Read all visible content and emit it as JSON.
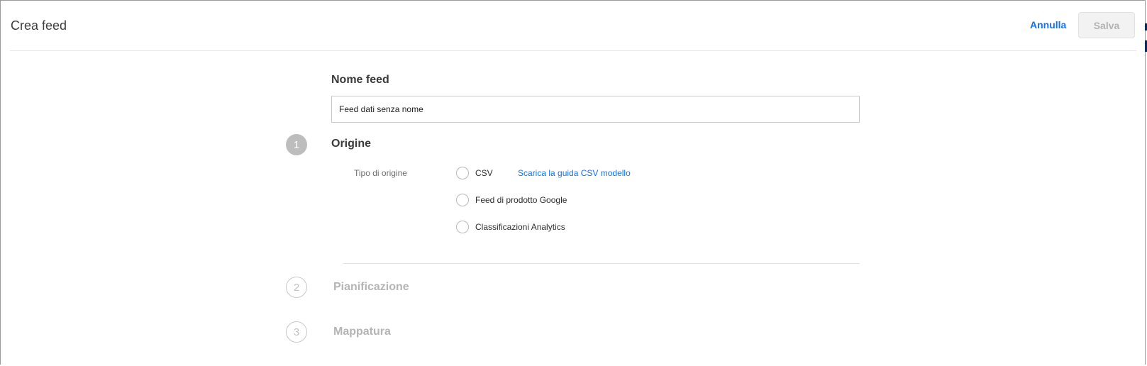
{
  "header": {
    "title": "Crea feed",
    "cancel_label": "Annulla",
    "save_label": "Salva"
  },
  "feed_name": {
    "label": "Nome feed",
    "value": "Feed dati senza nome"
  },
  "steps": [
    {
      "number": "1",
      "title": "Origine",
      "state": "active"
    },
    {
      "number": "2",
      "title": "Pianificazione",
      "state": "inactive"
    },
    {
      "number": "3",
      "title": "Mappatura",
      "state": "inactive"
    }
  ],
  "source": {
    "type_label": "Tipo di origine",
    "options": [
      {
        "label": "CSV",
        "selected": false
      },
      {
        "label": "Feed di prodotto Google",
        "selected": false
      },
      {
        "label": "Classificazioni Analytics",
        "selected": false
      }
    ],
    "csv_guide_link": "Scarica la guida CSV modello"
  },
  "colors": {
    "accent": "#1473e6",
    "active_step": "#bdbdbd",
    "inactive_text": "#b5b5b5"
  }
}
